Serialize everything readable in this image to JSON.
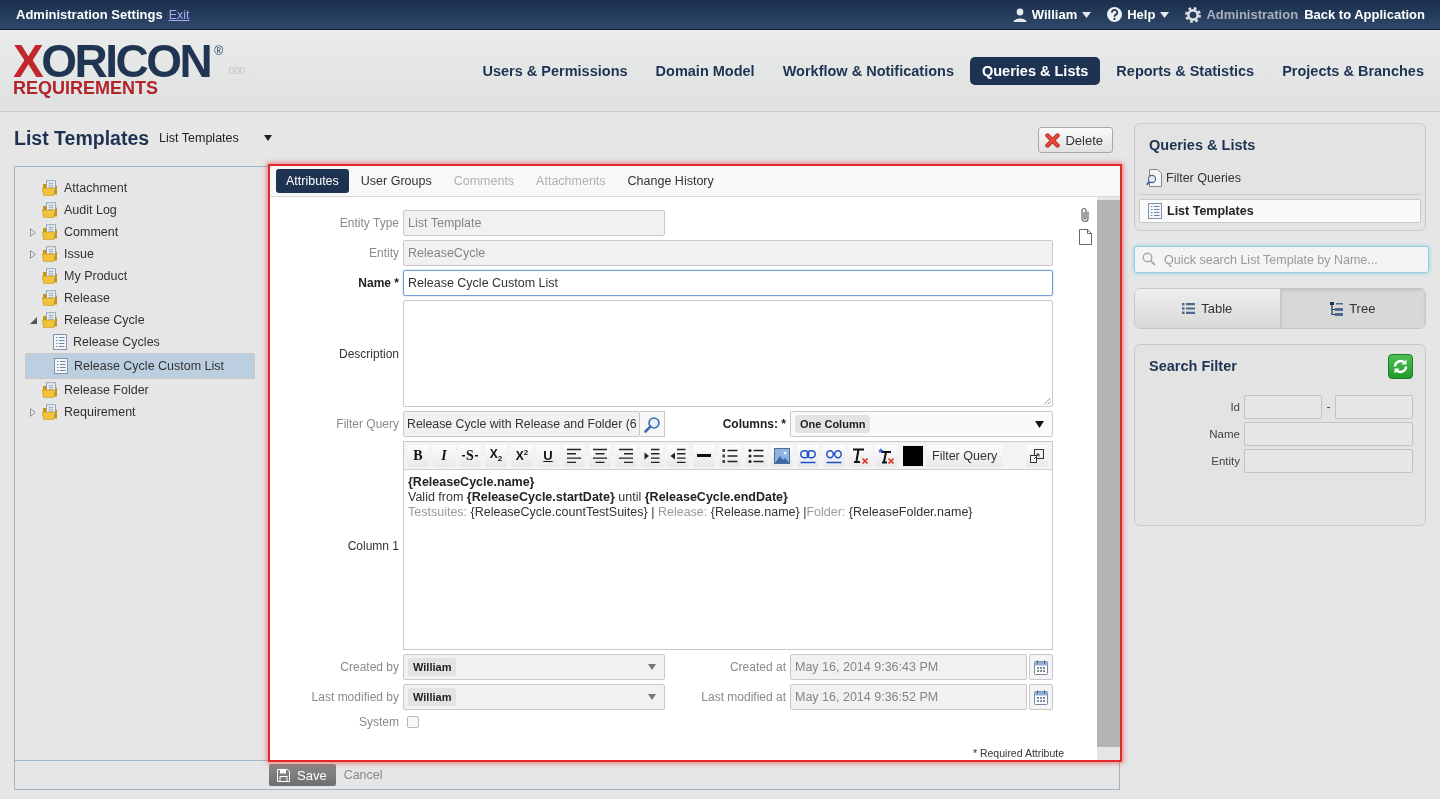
{
  "top_bar": {
    "title": "Administration Settings",
    "exit_link": "Exit",
    "user_menu": "William",
    "help_menu": "Help",
    "admin_label": "Administration",
    "back_link": "Back to Application"
  },
  "header": {
    "logo": {
      "name": "XORICON",
      "registered": "®",
      "subtitle": "REQUIREMENTS"
    },
    "nav": [
      {
        "label": "Users & Permissions",
        "selected": false
      },
      {
        "label": "Domain Model",
        "selected": false
      },
      {
        "label": "Workflow & Notifications",
        "selected": false
      },
      {
        "label": "Queries & Lists",
        "selected": true
      },
      {
        "label": "Reports & Statistics",
        "selected": false
      },
      {
        "label": "Projects & Branches",
        "selected": false
      }
    ]
  },
  "page": {
    "title": "List Templates",
    "view_select": "List Templates",
    "delete_button": "Delete"
  },
  "tree": {
    "items": [
      {
        "label": "Attachment",
        "kind": "folder",
        "collapsed": false,
        "expanded": false,
        "selected": false
      },
      {
        "label": "Audit Log",
        "kind": "folder",
        "collapsed": false,
        "expanded": false,
        "selected": false
      },
      {
        "label": "Comment",
        "kind": "folder",
        "collapsed": true,
        "expanded": false,
        "selected": false
      },
      {
        "label": "Issue",
        "kind": "folder",
        "collapsed": true,
        "expanded": false,
        "selected": false
      },
      {
        "label": "My Product",
        "kind": "folder",
        "collapsed": false,
        "expanded": false,
        "selected": false
      },
      {
        "label": "Release",
        "kind": "folder",
        "collapsed": false,
        "expanded": false,
        "selected": false
      },
      {
        "label": "Release Cycle",
        "kind": "folder",
        "collapsed": false,
        "expanded": true,
        "selected": false,
        "children": [
          {
            "label": "Release Cycles",
            "kind": "list",
            "collapsed": false,
            "expanded": false,
            "selected": false
          },
          {
            "label": "Release Cycle Custom List",
            "kind": "list",
            "collapsed": false,
            "expanded": false,
            "selected": true
          }
        ]
      },
      {
        "label": "Release Folder",
        "kind": "folder",
        "collapsed": false,
        "expanded": false,
        "selected": false
      },
      {
        "label": "Requirement",
        "kind": "folder",
        "collapsed": true,
        "expanded": false,
        "selected": false
      }
    ]
  },
  "form": {
    "tabs": [
      {
        "label": "Attributes",
        "selected": true,
        "disabled": false
      },
      {
        "label": "User Groups",
        "selected": false,
        "disabled": false
      },
      {
        "label": "Comments",
        "selected": false,
        "disabled": true
      },
      {
        "label": "Attachments",
        "selected": false,
        "disabled": true
      },
      {
        "label": "Change History",
        "selected": false,
        "disabled": false
      }
    ],
    "fields": {
      "entity_type": {
        "label": "Entity Type",
        "value": "List Template",
        "disabled": true
      },
      "entity": {
        "label": "Entity",
        "value": "ReleaseCycle",
        "disabled": true
      },
      "name": {
        "label": "Name *",
        "value": "Release Cycle Custom List",
        "required": true,
        "focused": true
      },
      "description": {
        "label": "Description",
        "disabled": false
      },
      "filter_query": {
        "label": "Filter Query",
        "value": "Release Cycle with Release and Folder (6",
        "disabled": true
      },
      "columns": {
        "label": "Columns: *",
        "value": "One Column",
        "required": true
      },
      "column_1": {
        "label": "Column 1",
        "disabled": false,
        "format_buttons": [
          {
            "label": "B",
            "kind": "bold"
          },
          {
            "label": "I",
            "kind": "italic"
          },
          {
            "label": "S",
            "kind": "strike"
          },
          {
            "label": "X$_{2}$",
            "kind": "plain"
          },
          {
            "label": "X$^{2}$",
            "kind": "plain"
          },
          {
            "label": "U",
            "kind": "underline"
          }
        ],
        "insert_button": "Filter Query",
        "lines": [
          {
            "segments": [
              {
                "text": "{ReleaseCycle.name}",
                "kind": "bold"
              }
            ]
          },
          {
            "segments": [
              {
                "text": "Valid from ",
                "kind": "plain"
              },
              {
                "text": "{ReleaseCycle.startDate}",
                "kind": "bold"
              },
              {
                "text": " until ",
                "kind": "plain"
              },
              {
                "text": "{ReleaseCycle.endDate}",
                "kind": "bold"
              }
            ]
          },
          {
            "segments": [
              {
                "text": "Testsuites: ",
                "kind": "muted"
              },
              {
                "text": "{ReleaseCycle.countTestSuites} | ",
                "kind": "plain"
              },
              {
                "text": "Release: ",
                "kind": "muted"
              },
              {
                "text": "{Release.name} |",
                "kind": "plain"
              },
              {
                "text": "Folder: ",
                "kind": "muted"
              },
              {
                "text": "{ReleaseFolder.name}",
                "kind": "plain"
              }
            ]
          }
        ]
      },
      "created_by": {
        "label": "Created by",
        "value": "William",
        "disabled": true
      },
      "created_at": {
        "label": "Created at",
        "value": "May 16, 2014 9:36:43 PM",
        "disabled": true
      },
      "last_modified_by": {
        "label": "Last modified by",
        "value": "William",
        "disabled": true
      },
      "last_modified_at": {
        "label": "Last modified at",
        "value": "May 16, 2014 9:36:52 PM",
        "disabled": true
      },
      "system": {
        "label": "System",
        "checked": false,
        "disabled": true
      }
    },
    "required_note": "* Required Attribute"
  },
  "footer": {
    "save_button": "Save",
    "cancel_link": "Cancel"
  },
  "sidebar": {
    "title": "Queries & Lists",
    "items": [
      {
        "label": "Filter Queries",
        "kind": "query",
        "selected": false
      },
      {
        "label": "List Templates",
        "kind": "list",
        "selected": true
      }
    ],
    "search": {
      "placeholder": "Quick search List Template by Name..."
    },
    "views": [
      {
        "label": "Table",
        "kind": "table",
        "selected": false
      },
      {
        "label": "Tree",
        "kind": "tree",
        "selected": true
      }
    ],
    "filter": {
      "title": "Search Filter",
      "fields": [
        {
          "label": "Id",
          "kind": "range",
          "separator": "-"
        },
        {
          "label": "Name",
          "kind": "text"
        },
        {
          "label": "Entity",
          "kind": "text"
        }
      ]
    }
  }
}
